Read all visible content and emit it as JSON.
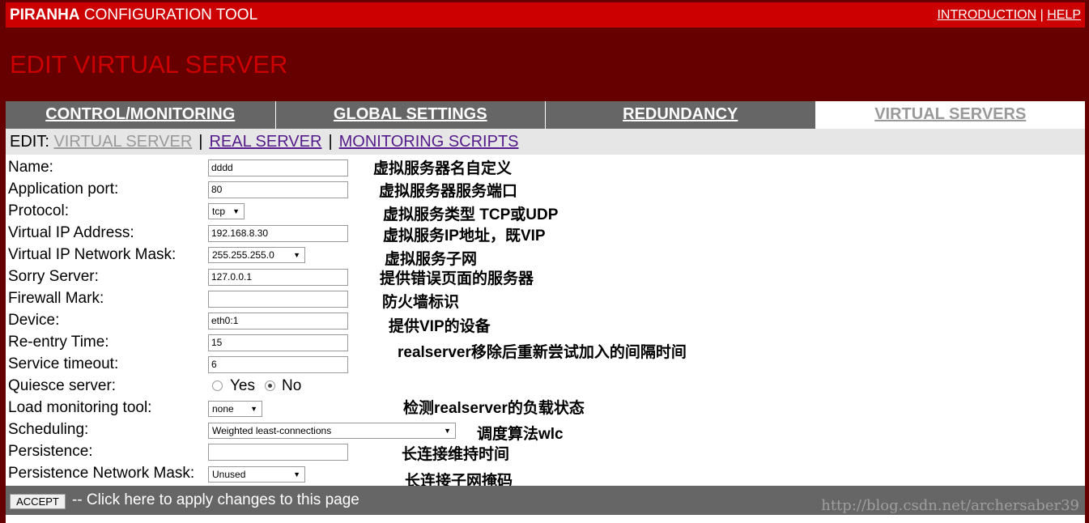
{
  "header": {
    "title_bold": "PIRANHA",
    "title_rest": "CONFIGURATION TOOL",
    "links": [
      {
        "label": "INTRODUCTION"
      },
      {
        "label": "HELP"
      }
    ],
    "link_separator": "|"
  },
  "page_heading": "EDIT VIRTUAL SERVER",
  "tabs": [
    {
      "label": "CONTROL/MONITORING",
      "active": false
    },
    {
      "label": "GLOBAL SETTINGS",
      "active": false
    },
    {
      "label": "REDUNDANCY",
      "active": false
    },
    {
      "label": "VIRTUAL SERVERS",
      "active": true
    }
  ],
  "subnav": {
    "prefix": "EDIT:",
    "items": [
      {
        "label": "VIRTUAL SERVER",
        "current": true
      },
      {
        "label": "REAL SERVER",
        "current": false
      },
      {
        "label": "MONITORING SCRIPTS",
        "current": false
      }
    ],
    "separator": "|"
  },
  "form": {
    "name": {
      "label": "Name:",
      "value": "dddd"
    },
    "app_port": {
      "label": "Application port:",
      "value": "80"
    },
    "protocol": {
      "label": "Protocol:",
      "value": "tcp"
    },
    "vip": {
      "label": "Virtual IP Address:",
      "value": "192.168.8.30"
    },
    "vip_mask": {
      "label": "Virtual IP Network Mask:",
      "value": "255.255.255.0"
    },
    "sorry_server": {
      "label": "Sorry Server:",
      "value": "127.0.0.1"
    },
    "firewall_mark": {
      "label": "Firewall Mark:",
      "value": ""
    },
    "device": {
      "label": "Device:",
      "value": "eth0:1"
    },
    "reentry_time": {
      "label": "Re-entry Time:",
      "value": "15"
    },
    "service_timeout": {
      "label": "Service timeout:",
      "value": "6"
    },
    "quiesce": {
      "label": "Quiesce server:",
      "options": [
        "Yes",
        "No"
      ],
      "selected": "No"
    },
    "load_monitor": {
      "label": "Load monitoring tool:",
      "value": "none"
    },
    "scheduling": {
      "label": "Scheduling:",
      "value": "Weighted least-connections"
    },
    "persistence": {
      "label": "Persistence:",
      "value": ""
    },
    "persistence_mask": {
      "label": "Persistence Network Mask:",
      "value": "Unused"
    }
  },
  "annotations": {
    "name": "虚拟服务器名自定义",
    "port": "虚拟服务器服务端口",
    "protocol": "虚拟服务类型 TCP或UDP",
    "vip": "虚拟服务IP地址，既VIP",
    "mask": "虚拟服务子网",
    "sorry": "提供错误页面的服务器",
    "firewall": "防火墙标识",
    "device": "提供VIP的设备",
    "reentry": "realserver移除后重新尝试加入的间隔时间",
    "load": "检测realserver的负载状态",
    "scheduling": "调度算法wlc",
    "persistence": "长连接维持时间",
    "persistence_mask": "长连接子网掩码"
  },
  "footer": {
    "accept_label": "ACCEPT",
    "accept_text": "-- Click here to apply changes to this page"
  },
  "watermark": "http://blog.csdn.net/archersaber39",
  "colors": {
    "header_red": "#cc0000",
    "background": "#660000",
    "tab_gray": "#666666",
    "subnav_bg": "#e6e6e6"
  }
}
